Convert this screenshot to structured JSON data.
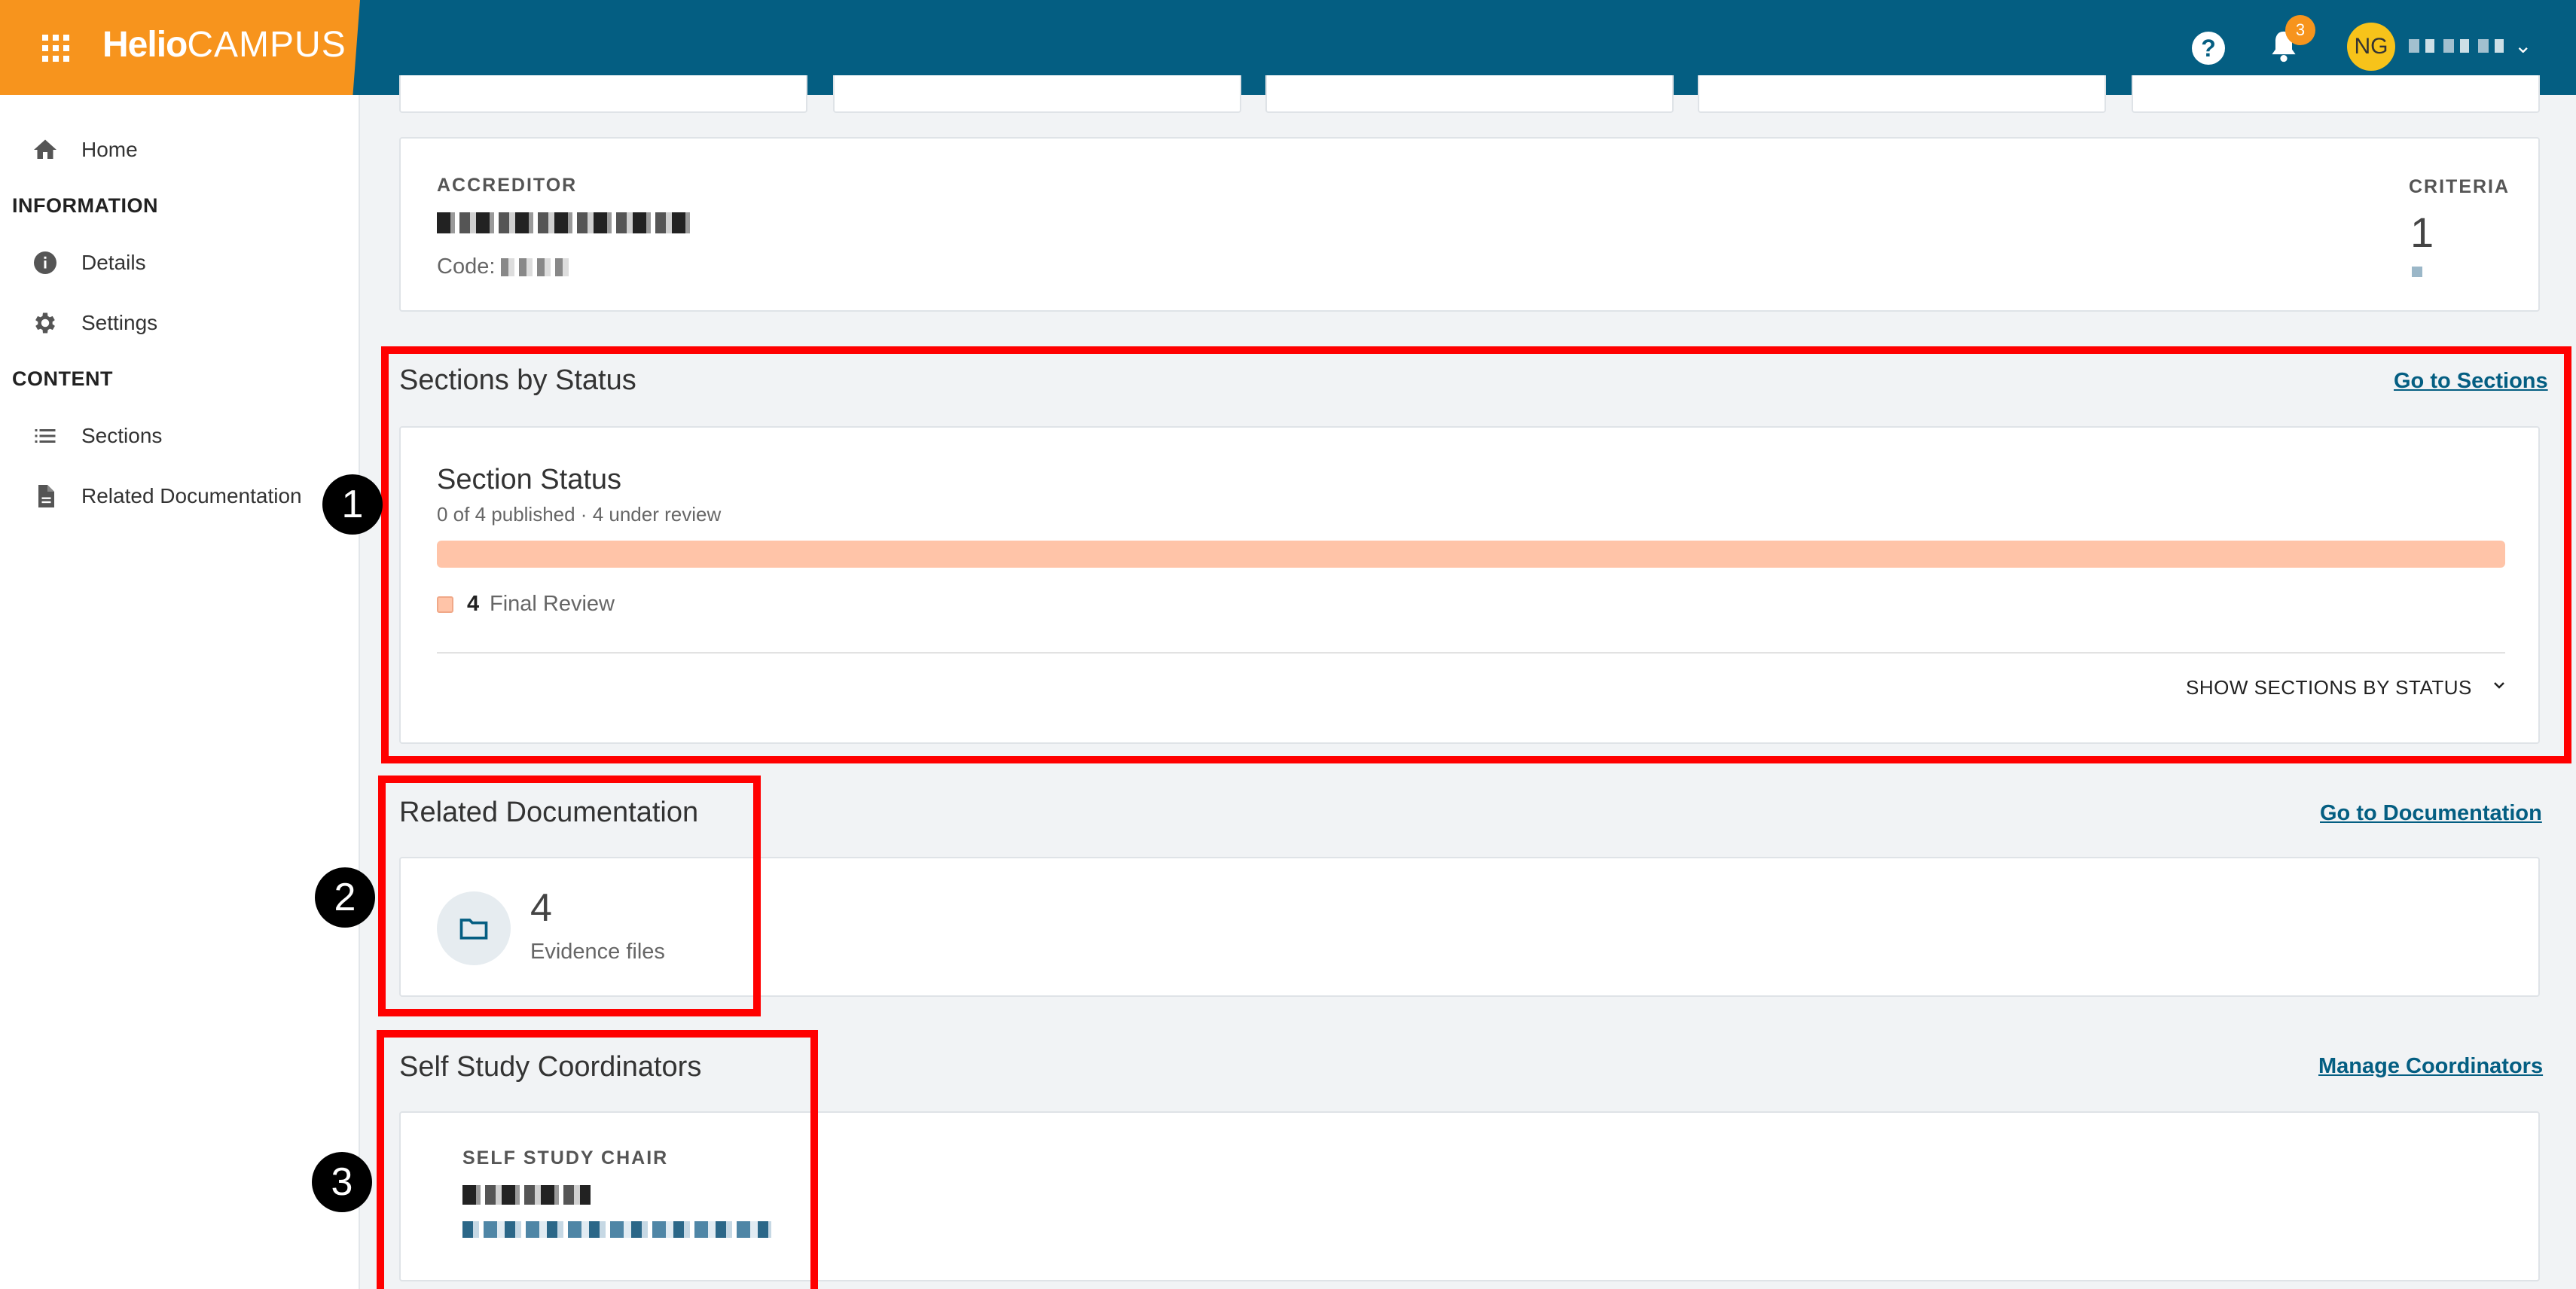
{
  "header": {
    "logo_part1": "Helio",
    "logo_part2": "CAMPUS",
    "notification_count": "3",
    "avatar_initials": "NG",
    "colors": {
      "topbar": "#045e82",
      "brand": "#f7941d",
      "avatar": "#f7c31a"
    }
  },
  "sidebar": {
    "home_label": "Home",
    "information_heading": "INFORMATION",
    "details_label": "Details",
    "settings_label": "Settings",
    "content_heading": "CONTENT",
    "sections_label": "Sections",
    "related_docs_label": "Related Documentation"
  },
  "accreditor": {
    "label": "ACCREDITOR",
    "code_label": "Code:",
    "criteria_label": "CRITERIA",
    "criteria_value": "1"
  },
  "sections_by_status": {
    "title": "Sections by Status",
    "link": "Go to Sections",
    "card_title": "Section Status",
    "summary": "0 of 4 published · 4 under review",
    "progress_fraction": 1.0,
    "progress_color": "#ffc4a8",
    "legend_count": "4",
    "legend_label": "Final Review",
    "toggle_label": "SHOW SECTIONS BY STATUS"
  },
  "related_documentation": {
    "title": "Related Documentation",
    "link": "Go to Documentation",
    "count": "4",
    "count_label": "Evidence files"
  },
  "coordinators": {
    "title": "Self Study Coordinators",
    "link": "Manage Coordinators",
    "role_label": "SELF STUDY CHAIR"
  },
  "annotations": {
    "marker1": "1",
    "marker2": "2",
    "marker3": "3",
    "highlight_color": "#ff0000"
  }
}
